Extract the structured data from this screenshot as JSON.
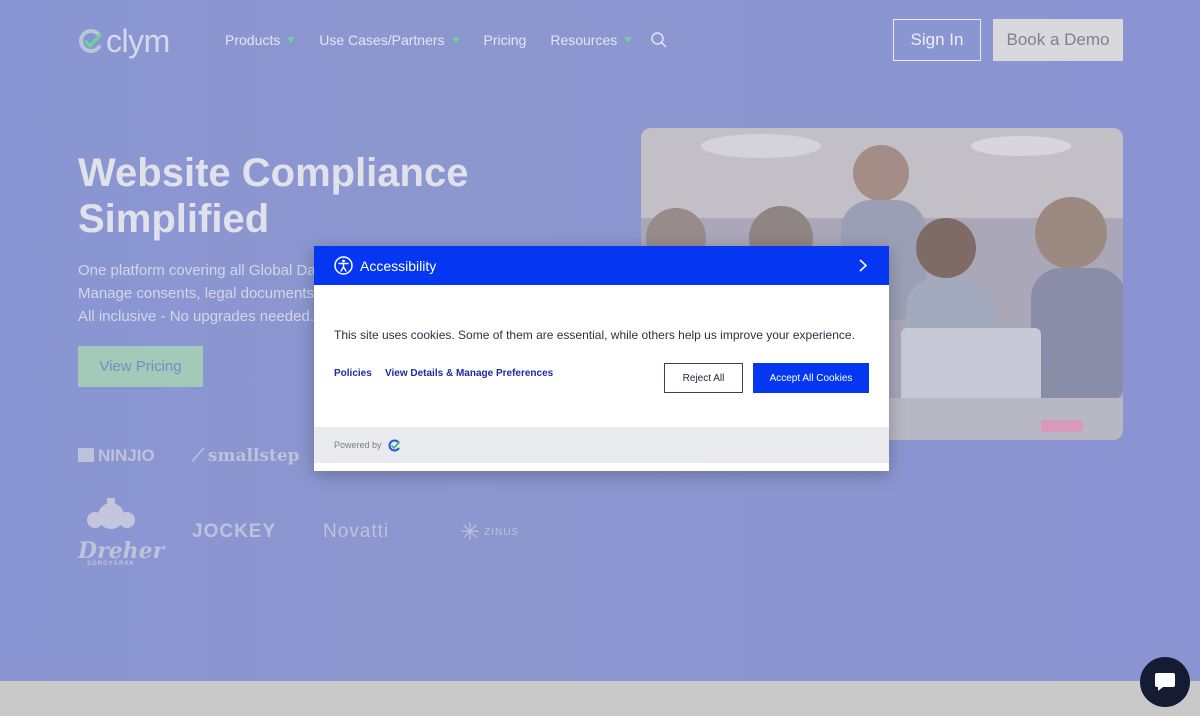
{
  "header": {
    "logo_text": "clym",
    "nav": [
      {
        "label": "Products",
        "has_dropdown": true
      },
      {
        "label": "Use Cases/Partners",
        "has_dropdown": true
      },
      {
        "label": "Pricing",
        "has_dropdown": false
      },
      {
        "label": "Resources",
        "has_dropdown": true
      }
    ],
    "search_icon": "search-icon",
    "sign_in_label": "Sign In",
    "book_demo_label": "Book a Demo"
  },
  "hero": {
    "title_line1": "Website Compliance",
    "title_line2": "Simplified",
    "description_lines": [
      "One platform covering all Global Da",
      "Manage consents, legal documents",
      "All inclusive - No upgrades needed."
    ],
    "cta_label": "View Pricing"
  },
  "logos": {
    "ninjio": "NINJIO",
    "smallstep": "smallstep",
    "dreher": "Dreher",
    "dreher_sub": "SÖRGYÁRAK",
    "jockey": "JOCKEY",
    "novatti": "Novatti",
    "zinus": "ZINUS"
  },
  "modal": {
    "title": "Accessibility",
    "message": "This site uses cookies. Some of them are essential, while others help us improve your experience.",
    "policies_label": "Policies",
    "details_label": "View Details & Manage Preferences",
    "reject_label": "Reject All",
    "accept_label": "Accept All Cookies",
    "powered_by": "Powered by"
  },
  "colors": {
    "modal_accent": "#0537f3",
    "page_overlay": "#8a96d3",
    "caret_green": "#6fd09a",
    "chat_button": "#141b33"
  }
}
